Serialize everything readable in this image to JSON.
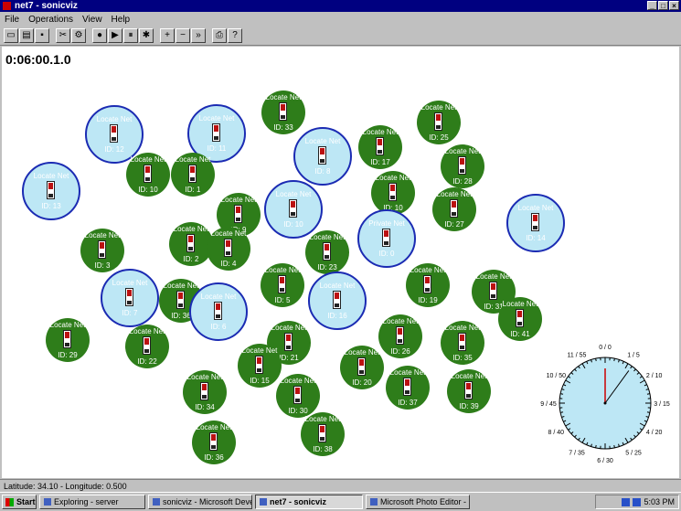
{
  "window": {
    "title": "net7 - sonicviz"
  },
  "window_controls": {
    "minimize": "_",
    "maximize": "□",
    "close": "×"
  },
  "menu": [
    "File",
    "Operations",
    "View",
    "Help"
  ],
  "toolbar": {
    "buttons": [
      {
        "name": "new-icon",
        "glyph": "▭"
      },
      {
        "name": "open-icon",
        "glyph": "▤"
      },
      {
        "name": "save-icon",
        "glyph": "▪"
      },
      {
        "name": "tool-a-icon",
        "glyph": "✂"
      },
      {
        "name": "tool-b-icon",
        "glyph": "⚙"
      },
      {
        "name": "record-icon",
        "glyph": "●"
      },
      {
        "name": "play-icon",
        "glyph": "▶"
      },
      {
        "name": "pause-icon",
        "glyph": "⏸"
      },
      {
        "name": "debug-icon",
        "glyph": "✱"
      },
      {
        "name": "zoom-in-icon",
        "glyph": "+"
      },
      {
        "name": "zoom-out-icon",
        "glyph": "−"
      },
      {
        "name": "fast-forward-icon",
        "glyph": "»"
      },
      {
        "name": "print-icon",
        "glyph": "⎙"
      },
      {
        "name": "help-icon",
        "glyph": "?"
      }
    ]
  },
  "timer": "0:06:00.1.0",
  "nodes": [
    {
      "label": "Locate Net",
      "id": "ID: 12",
      "ring": true
    },
    {
      "label": "Locate Net",
      "id": "ID: 11",
      "ring": true
    },
    {
      "label": "Locate Net",
      "id": "ID: 33",
      "ring": false
    },
    {
      "label": "Locate Net",
      "id": "ID: 25",
      "ring": false
    },
    {
      "label": "Locate Net",
      "id": "ID: 17",
      "ring": false
    },
    {
      "label": "Locate Net",
      "id": "ID: 28",
      "ring": false
    },
    {
      "label": "Locate Net",
      "id": "ID: 8",
      "ring": true
    },
    {
      "label": "Locate Net",
      "id": "ID: 13",
      "ring": true
    },
    {
      "label": "Locate Net",
      "id": "ID: 10",
      "ring": false
    },
    {
      "label": "Locate Net",
      "id": "ID: 1",
      "ring": false
    },
    {
      "label": "Locate Net",
      "id": "ID: 10",
      "ring": true
    },
    {
      "label": "Locate Net",
      "id": "ID: 10",
      "ring": false
    },
    {
      "label": "Locate Net",
      "id": "ID: 27",
      "ring": false
    },
    {
      "label": "Locate Net",
      "id": "ID: 14",
      "ring": true
    },
    {
      "label": "Locate Net",
      "id": "ID: 9",
      "ring": false
    },
    {
      "label": "Locate Net",
      "id": "ID: 2",
      "ring": false
    },
    {
      "label": "Locate Net",
      "id": "ID: 4",
      "ring": false
    },
    {
      "label": "Locate Net",
      "id": "ID: 23",
      "ring": false
    },
    {
      "label": "Private Net",
      "id": "ID: 0",
      "ring": true
    },
    {
      "label": "Locate Net",
      "id": "ID: 3",
      "ring": false
    },
    {
      "label": "Locate Net",
      "id": "ID: 7",
      "ring": true
    },
    {
      "label": "Locate Net",
      "id": "ID: 36",
      "ring": false
    },
    {
      "label": "Locate Net",
      "id": "ID: 6",
      "ring": true
    },
    {
      "label": "Locate Net",
      "id": "ID: 5",
      "ring": false
    },
    {
      "label": "Locate Net",
      "id": "ID: 16",
      "ring": true
    },
    {
      "label": "Locate Net",
      "id": "ID: 19",
      "ring": false
    },
    {
      "label": "Locate Net",
      "id": "ID: 31",
      "ring": false
    },
    {
      "label": "Locate Net",
      "id": "ID: 41",
      "ring": false
    },
    {
      "label": "Locate Net",
      "id": "ID: 29",
      "ring": false
    },
    {
      "label": "Locate Net",
      "id": "ID: 22",
      "ring": false
    },
    {
      "label": "Locate Net",
      "id": "ID: 21",
      "ring": false
    },
    {
      "label": "Locate Net",
      "id": "ID: 26",
      "ring": false
    },
    {
      "label": "Locate Net",
      "id": "ID: 35",
      "ring": false
    },
    {
      "label": "Locate Net",
      "id": "ID: 15",
      "ring": false
    },
    {
      "label": "Locate Net",
      "id": "ID: 20",
      "ring": false
    },
    {
      "label": "Locate Net",
      "id": "ID: 37",
      "ring": false
    },
    {
      "label": "Locate Net",
      "id": "ID: 39",
      "ring": false
    },
    {
      "label": "Locate Net",
      "id": "ID: 34",
      "ring": false
    },
    {
      "label": "Locate Net",
      "id": "ID: 30",
      "ring": false
    },
    {
      "label": "Locate Net",
      "id": "ID: 38",
      "ring": false
    },
    {
      "label": "Locate Net",
      "id": "ID: 36",
      "ring": false
    }
  ],
  "clock": {
    "labels": [
      "0 / 0",
      "1 / 5",
      "2 / 10",
      "3 / 15",
      "4 / 20",
      "5 / 25",
      "6 / 30",
      "7 / 35",
      "8 / 40",
      "9 / 45",
      "10 / 50",
      "11 / 55"
    ],
    "hour_value": 0,
    "minute_value": 6
  },
  "status": "Latitude: 34.10 - Longitude: 0.500",
  "taskbar": {
    "start": "Start",
    "tasks": [
      "Exploring - server",
      "sonicviz - Microsoft Devel...",
      "net7 - sonicviz",
      "Microsoft Photo Editor - [s..."
    ],
    "active_index": 2,
    "time": "5:03 PM"
  },
  "colors": {
    "node_fill": "#2e7d1a",
    "ring_fill": "#bde7f5",
    "ring_border": "#1b2bb3",
    "clock_face": "#bde7f5"
  }
}
